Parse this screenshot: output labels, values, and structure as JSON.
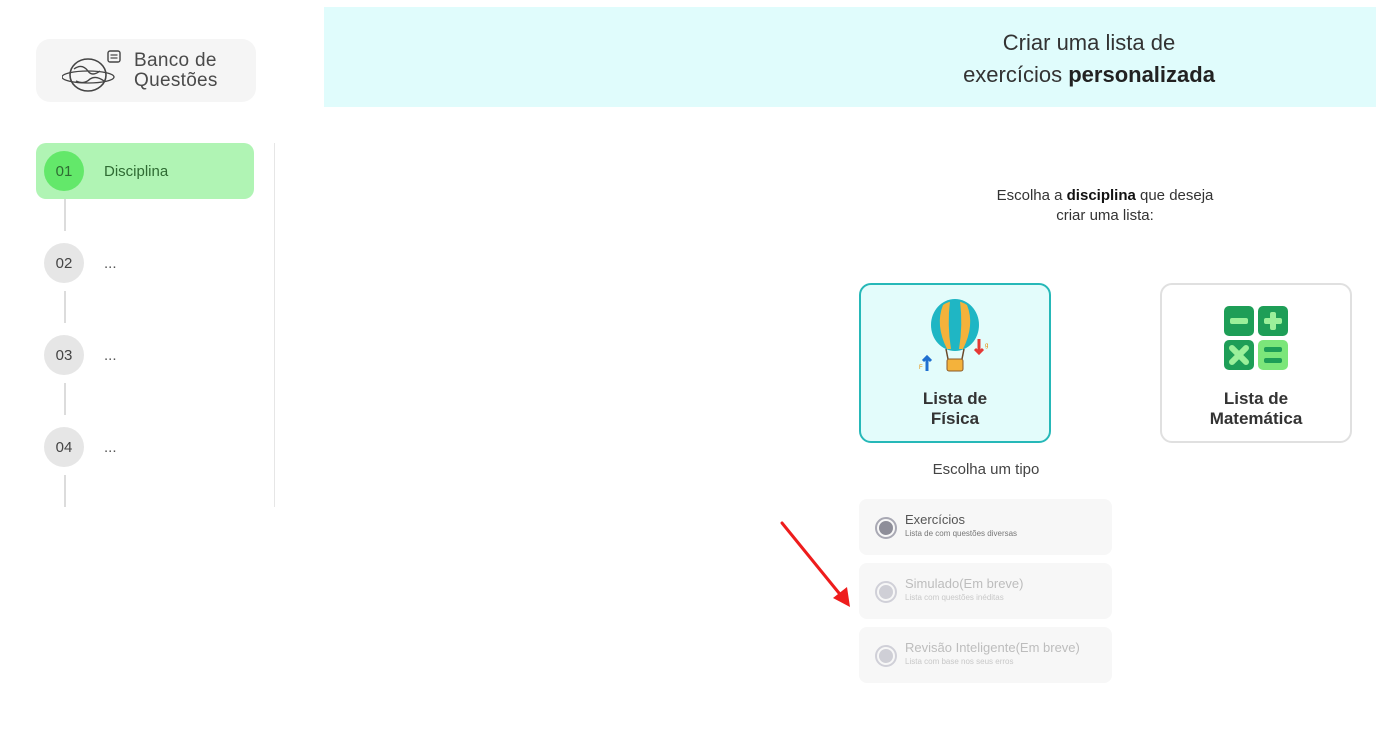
{
  "logo": {
    "line1": "Banco de",
    "line2": "Questões"
  },
  "steps": [
    {
      "num": "01",
      "label": "Disciplina",
      "active": true
    },
    {
      "num": "02",
      "label": "..."
    },
    {
      "num": "03",
      "label": "..."
    },
    {
      "num": "04",
      "label": "..."
    }
  ],
  "banner": {
    "line1": "Criar uma lista de",
    "line2_plain": "exercícios ",
    "line2_bold": "personalizada"
  },
  "prompt": {
    "prefix": "Escolha a ",
    "bold": "disciplina",
    "suffix": " que deseja",
    "line2": "criar uma lista:"
  },
  "cards": [
    {
      "line1": "Lista de",
      "line2": "Física",
      "icon": "hot-air-balloon-icon",
      "selected": true
    },
    {
      "line1": "Lista de",
      "line2": "Matemática",
      "icon": "math-operators-icon",
      "selected": false
    }
  ],
  "type_title": "Escolha um tipo",
  "options": [
    {
      "title": "Exercícios",
      "subtitle": "Lista de com questões diversas",
      "disabled": false
    },
    {
      "title": "Simulado(Em breve)",
      "subtitle": "Lista com questões inéditas",
      "disabled": true
    },
    {
      "title": "Revisão Inteligente(Em breve)",
      "subtitle": "Lista com base nos seus erros",
      "disabled": true
    }
  ],
  "colors": {
    "accent": "#26b8b8",
    "active_step": "#b0f4b4",
    "banner_bg": "#e0fcfc",
    "annotation_arrow": "#ee1c1c"
  }
}
